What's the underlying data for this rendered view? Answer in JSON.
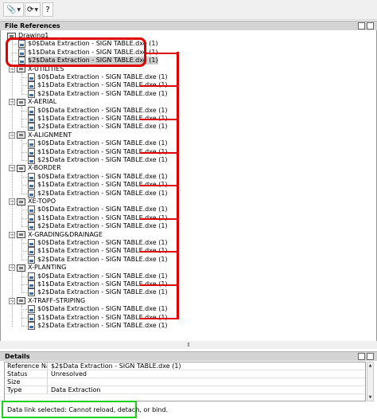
{
  "toolbar": {
    "attach_icon": "attach-dropdown-icon",
    "refresh_icon": "refresh-icon",
    "help_label": "?"
  },
  "file_references": {
    "title": "File References",
    "root": "Drawing1",
    "top_items": [
      "$0$Data Extraction - SIGN TABLE.dxe (1)",
      "$1$Data Extraction - SIGN TABLE.dxe (1)",
      "$2$Data Extraction - SIGN TABLE.dxe (1)"
    ],
    "groups": [
      {
        "name": "X-UTILITIES",
        "items": [
          "$0$Data Extraction - SIGN TABLE.dxe (1)",
          "$1$Data Extraction - SIGN TABLE.dxe (1)",
          "$2$Data Extraction - SIGN TABLE.dxe (1)"
        ]
      },
      {
        "name": "X-AERIAL",
        "items": [
          "$0$Data Extraction - SIGN TABLE.dxe (1)",
          "$1$Data Extraction - SIGN TABLE.dxe (1)",
          "$2$Data Extraction - SIGN TABLE.dxe (1)"
        ]
      },
      {
        "name": "X-ALIGNMENT",
        "items": [
          "$0$Data Extraction - SIGN TABLE.dxe (1)",
          "$1$Data Extraction - SIGN TABLE.dxe (1)",
          "$2$Data Extraction - SIGN TABLE.dxe (1)"
        ]
      },
      {
        "name": "X-BORDER",
        "items": [
          "$0$Data Extraction - SIGN TABLE.dxe (1)",
          "$1$Data Extraction - SIGN TABLE.dxe (1)",
          "$2$Data Extraction - SIGN TABLE.dxe (1)"
        ]
      },
      {
        "name": "XE-TOPO",
        "items": [
          "$0$Data Extraction - SIGN TABLE.dxe (1)",
          "$1$Data Extraction - SIGN TABLE.dxe (1)",
          "$2$Data Extraction - SIGN TABLE.dxe (1)"
        ]
      },
      {
        "name": "X-GRADING&DRAINAGE",
        "items": [
          "$0$Data Extraction - SIGN TABLE.dxe (1)",
          "$1$Data Extraction - SIGN TABLE.dxe (1)",
          "$2$Data Extraction - SIGN TABLE.dxe (1)"
        ]
      },
      {
        "name": "X-PLANTING",
        "items": [
          "$0$Data Extraction - SIGN TABLE.dxe (1)",
          "$1$Data Extraction - SIGN TABLE.dxe (1)",
          "$2$Data Extraction - SIGN TABLE.dxe (1)"
        ]
      },
      {
        "name": "X-TRAFF-STRIPING",
        "items": [
          "$0$Data Extraction - SIGN TABLE.dxe (1)",
          "$1$Data Extraction - SIGN TABLE.dxe (1)",
          "$2$Data Extraction - SIGN TABLE.dxe (1)"
        ]
      }
    ]
  },
  "details": {
    "title": "Details",
    "rows": [
      {
        "key": "Reference Na...",
        "value": "$2$Data Extraction - SIGN TABLE.dxe (1)"
      },
      {
        "key": "Status",
        "value": "Unresolved"
      },
      {
        "key": "Size",
        "value": ""
      },
      {
        "key": "Type",
        "value": "Data Extraction"
      }
    ]
  },
  "status_bar": {
    "message": "Data link selected: Cannot reload, detach, or bind."
  },
  "colors": {
    "highlight_red": "#e00000",
    "highlight_green": "#1ed01e"
  }
}
